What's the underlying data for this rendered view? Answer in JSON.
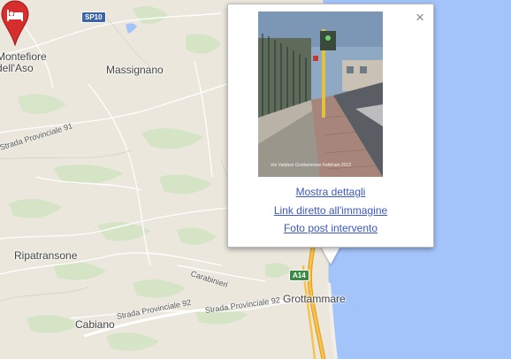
{
  "map": {
    "places": [
      {
        "id": "montefiore",
        "text": "Montefiore\ndell'Aso"
      },
      {
        "id": "massignano",
        "text": "Massignano"
      },
      {
        "id": "ripatransone",
        "text": "Ripatransone"
      },
      {
        "id": "cabiano",
        "text": "Cabiano"
      },
      {
        "id": "grottammare",
        "text": "Grottammare"
      }
    ],
    "roads": {
      "provinciale_91": "Strada Provinciale 91",
      "provinciale_92_a": "Strada Provinciale 92",
      "provinciale_92_b": "Strada Provinciale 92",
      "carabinieri": "Carabinieri"
    },
    "shields": {
      "sp10": "SP10",
      "a14_top": "A14",
      "a14_bottom": "A14"
    },
    "colors": {
      "sea": "#a3c4fb",
      "land": "#ebe7dd",
      "highway": "#f8c24a",
      "marker": "#d62d2d"
    }
  },
  "popup": {
    "close_icon": "×",
    "photo_caption": "Via Valdaso   Grottammare   Febbraio 2013",
    "links": {
      "details": "Mostra dettagli",
      "direct_link": "Link diretto all'immagine",
      "post_photo": "Foto post intervento"
    }
  },
  "marker": {
    "icon": "bed-icon"
  }
}
